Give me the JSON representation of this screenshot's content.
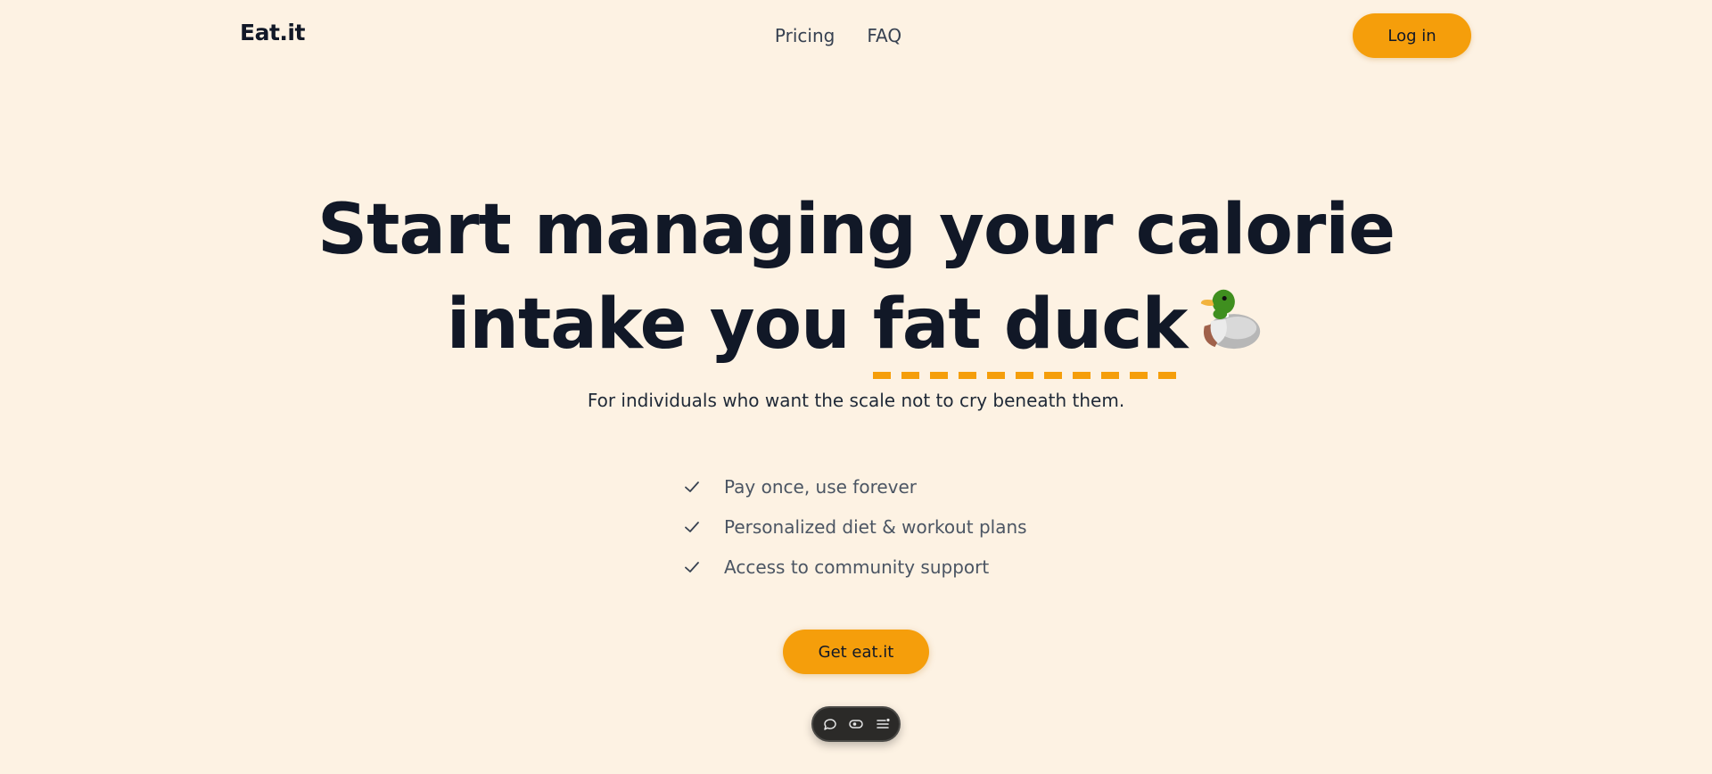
{
  "header": {
    "logo": "Eat.it",
    "nav": [
      {
        "label": "Pricing"
      },
      {
        "label": "FAQ"
      }
    ],
    "login_label": "Log in"
  },
  "hero": {
    "title_line1": "Start managing your calorie",
    "title_line2_prefix": "intake you ",
    "title_highlight": "fat duck",
    "title_emoji_icon": "duck-icon",
    "subtitle": "For individuals who want the scale not to cry beneath them.",
    "features": [
      {
        "icon": "check-icon",
        "label": "Pay once, use forever"
      },
      {
        "icon": "check-icon",
        "label": "Personalized diet & workout plans"
      },
      {
        "icon": "check-icon",
        "label": "Access to community support"
      }
    ],
    "cta_label": "Get eat.it"
  },
  "toolbar": {
    "items": [
      {
        "icon": "comment-icon"
      },
      {
        "icon": "eye-icon"
      },
      {
        "icon": "menu-list-icon"
      }
    ]
  },
  "colors": {
    "background": "#fdf2e3",
    "accent": "#f59e0b",
    "text_dark": "#111827",
    "text_muted": "#4b5563",
    "toolbar_bg": "#2b2a28"
  }
}
